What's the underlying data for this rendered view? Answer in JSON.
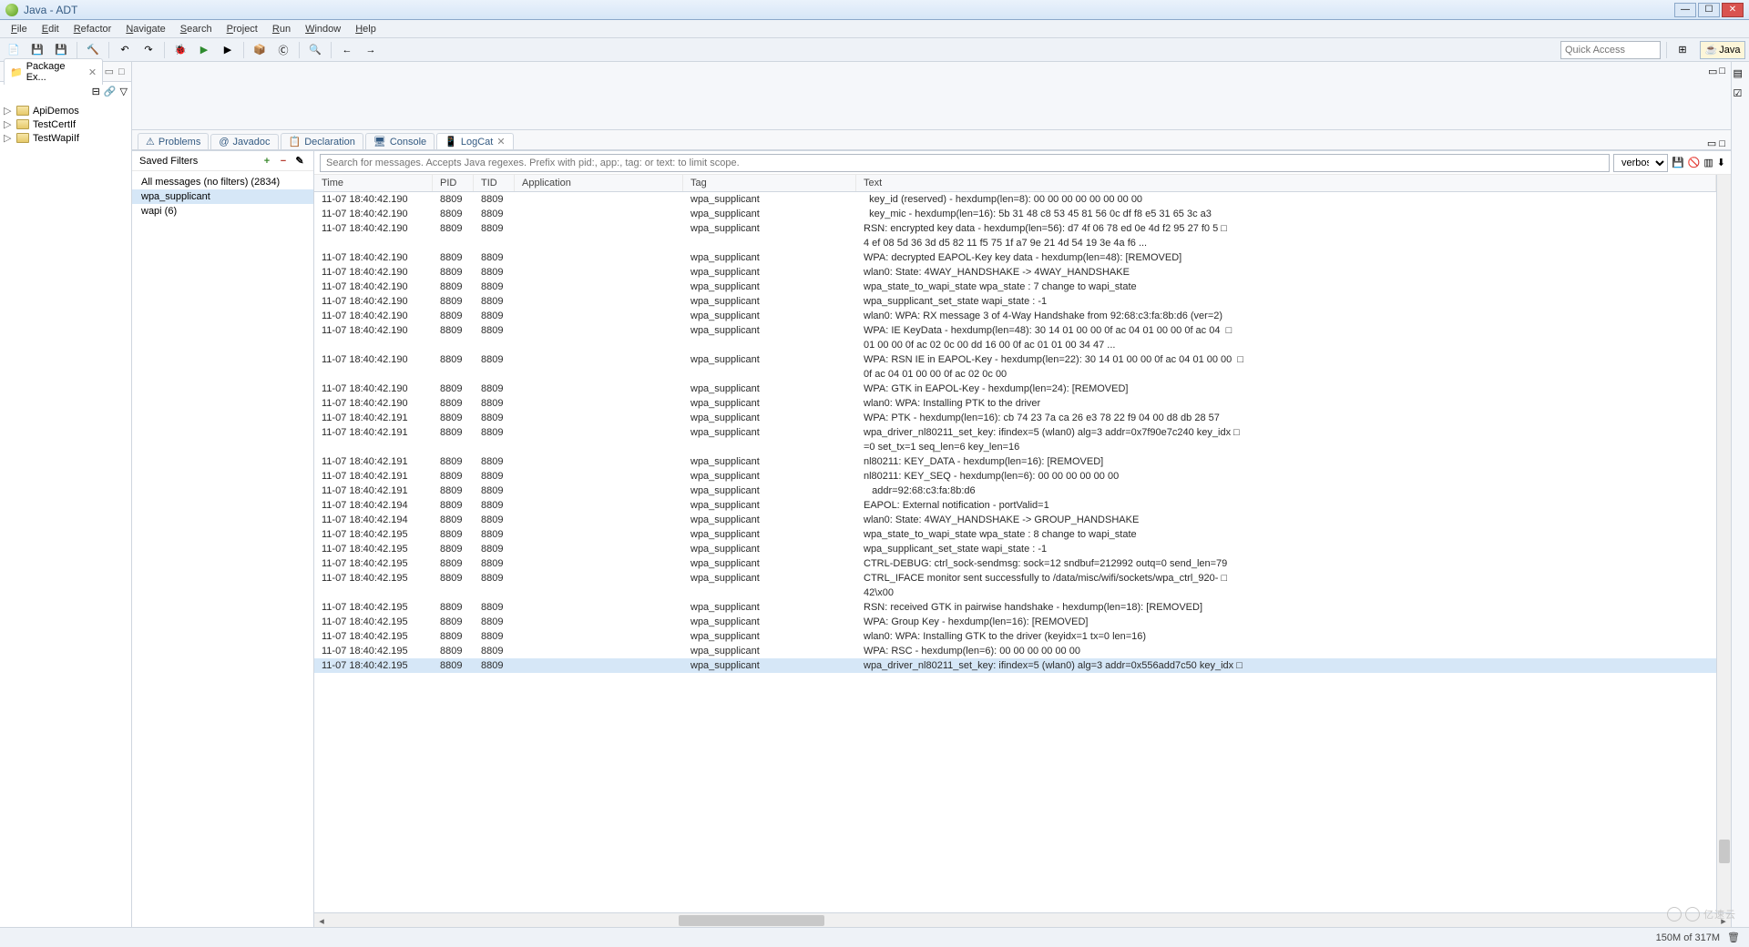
{
  "titlebar": {
    "title": "Java - ADT"
  },
  "menubar": [
    "File",
    "Edit",
    "Refactor",
    "Navigate",
    "Search",
    "Project",
    "Run",
    "Window",
    "Help"
  ],
  "quick_access_placeholder": "Quick Access",
  "perspective_label": "Java",
  "package_explorer": {
    "title": "Package Ex...",
    "items": [
      "ApiDemos",
      "TestCertIf",
      "TestWapiIf"
    ]
  },
  "bottom_tabs": [
    "Problems",
    "Javadoc",
    "Declaration",
    "Console",
    "LogCat"
  ],
  "active_bottom_tab": 4,
  "saved_filters": {
    "title": "Saved Filters",
    "items": [
      "All messages (no filters) (2834)",
      "wpa_supplicant",
      "wapi (6)"
    ],
    "selected": 1
  },
  "search_placeholder": "Search for messages. Accepts Java regexes. Prefix with pid:, app:, tag: or text: to limit scope.",
  "level": "verbose",
  "log_columns": [
    "Time",
    "PID",
    "TID",
    "Application",
    "Tag",
    "Text"
  ],
  "log_rows": [
    {
      "time": "11-07 18:40:42.190",
      "pid": "8809",
      "tid": "8809",
      "tag": "wpa_supplicant",
      "text": "  key_id (reserved) - hexdump(len=8): 00 00 00 00 00 00 00 00"
    },
    {
      "time": "11-07 18:40:42.190",
      "pid": "8809",
      "tid": "8809",
      "tag": "wpa_supplicant",
      "text": "  key_mic - hexdump(len=16): 5b 31 48 c8 53 45 81 56 0c df f8 e5 31 65 3c a3"
    },
    {
      "time": "11-07 18:40:42.190",
      "pid": "8809",
      "tid": "8809",
      "tag": "wpa_supplicant",
      "text": "RSN: encrypted key data - hexdump(len=56): d7 4f 06 78 ed 0e 4d f2 95 27 f0 5 □"
    },
    {
      "time": "",
      "pid": "",
      "tid": "",
      "tag": "",
      "text": "4 ef 08 5d 36 3d d5 82 11 f5 75 1f a7 9e 21 4d 54 19 3e 4a f6 ..."
    },
    {
      "time": "11-07 18:40:42.190",
      "pid": "8809",
      "tid": "8809",
      "tag": "wpa_supplicant",
      "text": "WPA: decrypted EAPOL-Key key data - hexdump(len=48): [REMOVED]"
    },
    {
      "time": "11-07 18:40:42.190",
      "pid": "8809",
      "tid": "8809",
      "tag": "wpa_supplicant",
      "text": "wlan0: State: 4WAY_HANDSHAKE -> 4WAY_HANDSHAKE"
    },
    {
      "time": "11-07 18:40:42.190",
      "pid": "8809",
      "tid": "8809",
      "tag": "wpa_supplicant",
      "text": "wpa_state_to_wapi_state wpa_state : 7 change to wapi_state"
    },
    {
      "time": "11-07 18:40:42.190",
      "pid": "8809",
      "tid": "8809",
      "tag": "wpa_supplicant",
      "text": "wpa_supplicant_set_state wapi_state : -1"
    },
    {
      "time": "11-07 18:40:42.190",
      "pid": "8809",
      "tid": "8809",
      "tag": "wpa_supplicant",
      "text": "wlan0: WPA: RX message 3 of 4-Way Handshake from 92:68:c3:fa:8b:d6 (ver=2)"
    },
    {
      "time": "11-07 18:40:42.190",
      "pid": "8809",
      "tid": "8809",
      "tag": "wpa_supplicant",
      "text": "WPA: IE KeyData - hexdump(len=48): 30 14 01 00 00 0f ac 04 01 00 00 0f ac 04  □"
    },
    {
      "time": "",
      "pid": "",
      "tid": "",
      "tag": "",
      "text": "01 00 00 0f ac 02 0c 00 dd 16 00 0f ac 01 01 00 34 47 ..."
    },
    {
      "time": "11-07 18:40:42.190",
      "pid": "8809",
      "tid": "8809",
      "tag": "wpa_supplicant",
      "text": "WPA: RSN IE in EAPOL-Key - hexdump(len=22): 30 14 01 00 00 0f ac 04 01 00 00  □"
    },
    {
      "time": "",
      "pid": "",
      "tid": "",
      "tag": "",
      "text": "0f ac 04 01 00 00 0f ac 02 0c 00"
    },
    {
      "time": "11-07 18:40:42.190",
      "pid": "8809",
      "tid": "8809",
      "tag": "wpa_supplicant",
      "text": "WPA: GTK in EAPOL-Key - hexdump(len=24): [REMOVED]"
    },
    {
      "time": "11-07 18:40:42.190",
      "pid": "8809",
      "tid": "8809",
      "tag": "wpa_supplicant",
      "text": "wlan0: WPA: Installing PTK to the driver"
    },
    {
      "time": "11-07 18:40:42.191",
      "pid": "8809",
      "tid": "8809",
      "tag": "wpa_supplicant",
      "text": "WPA: PTK - hexdump(len=16): cb 74 23 7a ca 26 e3 78 22 f9 04 00 d8 db 28 57"
    },
    {
      "time": "11-07 18:40:42.191",
      "pid": "8809",
      "tid": "8809",
      "tag": "wpa_supplicant",
      "text": "wpa_driver_nl80211_set_key: ifindex=5 (wlan0) alg=3 addr=0x7f90e7c240 key_idx □"
    },
    {
      "time": "",
      "pid": "",
      "tid": "",
      "tag": "",
      "text": "=0 set_tx=1 seq_len=6 key_len=16"
    },
    {
      "time": "11-07 18:40:42.191",
      "pid": "8809",
      "tid": "8809",
      "tag": "wpa_supplicant",
      "text": "nl80211: KEY_DATA - hexdump(len=16): [REMOVED]"
    },
    {
      "time": "11-07 18:40:42.191",
      "pid": "8809",
      "tid": "8809",
      "tag": "wpa_supplicant",
      "text": "nl80211: KEY_SEQ - hexdump(len=6): 00 00 00 00 00 00"
    },
    {
      "time": "11-07 18:40:42.191",
      "pid": "8809",
      "tid": "8809",
      "tag": "wpa_supplicant",
      "text": "   addr=92:68:c3:fa:8b:d6"
    },
    {
      "time": "11-07 18:40:42.194",
      "pid": "8809",
      "tid": "8809",
      "tag": "wpa_supplicant",
      "text": "EAPOL: External notification - portValid=1"
    },
    {
      "time": "11-07 18:40:42.194",
      "pid": "8809",
      "tid": "8809",
      "tag": "wpa_supplicant",
      "text": "wlan0: State: 4WAY_HANDSHAKE -> GROUP_HANDSHAKE"
    },
    {
      "time": "11-07 18:40:42.195",
      "pid": "8809",
      "tid": "8809",
      "tag": "wpa_supplicant",
      "text": "wpa_state_to_wapi_state wpa_state : 8 change to wapi_state"
    },
    {
      "time": "11-07 18:40:42.195",
      "pid": "8809",
      "tid": "8809",
      "tag": "wpa_supplicant",
      "text": "wpa_supplicant_set_state wapi_state : -1"
    },
    {
      "time": "11-07 18:40:42.195",
      "pid": "8809",
      "tid": "8809",
      "tag": "wpa_supplicant",
      "text": "CTRL-DEBUG: ctrl_sock-sendmsg: sock=12 sndbuf=212992 outq=0 send_len=79"
    },
    {
      "time": "11-07 18:40:42.195",
      "pid": "8809",
      "tid": "8809",
      "tag": "wpa_supplicant",
      "text": "CTRL_IFACE monitor sent successfully to /data/misc/wifi/sockets/wpa_ctrl_920- □"
    },
    {
      "time": "",
      "pid": "",
      "tid": "",
      "tag": "",
      "text": "42\\x00"
    },
    {
      "time": "11-07 18:40:42.195",
      "pid": "8809",
      "tid": "8809",
      "tag": "wpa_supplicant",
      "text": "RSN: received GTK in pairwise handshake - hexdump(len=18): [REMOVED]"
    },
    {
      "time": "11-07 18:40:42.195",
      "pid": "8809",
      "tid": "8809",
      "tag": "wpa_supplicant",
      "text": "WPA: Group Key - hexdump(len=16): [REMOVED]"
    },
    {
      "time": "11-07 18:40:42.195",
      "pid": "8809",
      "tid": "8809",
      "tag": "wpa_supplicant",
      "text": "wlan0: WPA: Installing GTK to the driver (keyidx=1 tx=0 len=16)"
    },
    {
      "time": "11-07 18:40:42.195",
      "pid": "8809",
      "tid": "8809",
      "tag": "wpa_supplicant",
      "text": "WPA: RSC - hexdump(len=6): 00 00 00 00 00 00"
    },
    {
      "time": "11-07 18:40:42.195",
      "pid": "8809",
      "tid": "8809",
      "tag": "wpa_supplicant",
      "text": "wpa_driver_nl80211_set_key: ifindex=5 (wlan0) alg=3 addr=0x556add7c50 key_idx □",
      "sel": true
    }
  ],
  "status": {
    "heap": "150M of 317M"
  },
  "watermark": "亿速云"
}
